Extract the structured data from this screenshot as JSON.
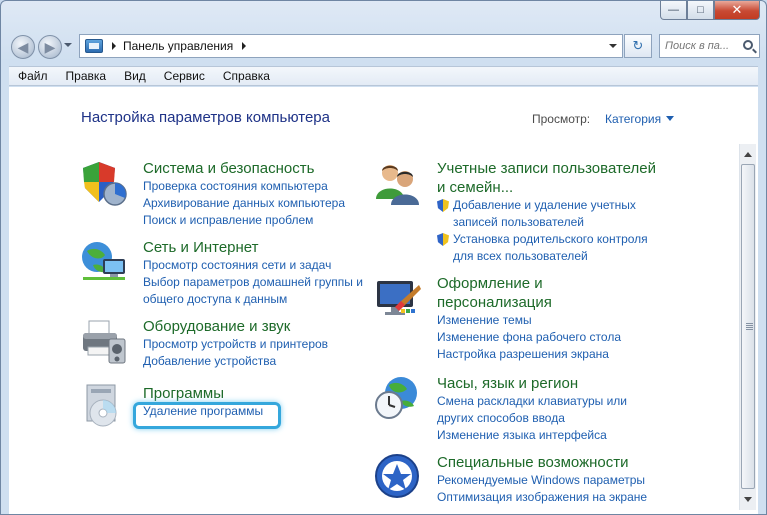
{
  "window": {
    "caption": {
      "minimize": "—",
      "maximize": "□",
      "close": "✕"
    }
  },
  "nav": {
    "back_icon": "◀",
    "forward_icon": "▶",
    "address_path": "Панель управления",
    "refresh_icon": "↻",
    "search_placeholder": "Поиск в па..."
  },
  "menu": [
    "Файл",
    "Правка",
    "Вид",
    "Сервис",
    "Справка"
  ],
  "page": {
    "title": "Настройка параметров компьютера",
    "view_label": "Просмотр:",
    "view_value": "Категория"
  },
  "categories_left": [
    {
      "title": "Система и безопасность",
      "links": [
        "Проверка состояния компьютера",
        "Архивирование данных компьютера",
        "Поиск и исправление проблем"
      ]
    },
    {
      "title": "Сеть и Интернет",
      "links": [
        "Просмотр состояния сети и задач",
        "Выбор параметров домашней группы и",
        "общего доступа к данным"
      ]
    },
    {
      "title": "Оборудование и звук",
      "links": [
        "Просмотр устройств и принтеров",
        "Добавление устройства"
      ]
    },
    {
      "title": "Программы",
      "links": [
        "Удаление программы"
      ]
    }
  ],
  "categories_right": [
    {
      "title_line1": "Учетные записи пользователей",
      "title_line2": "и семейн...",
      "links": [
        {
          "line1": "Добавление и удаление учетных",
          "line2": "записей пользователей"
        },
        {
          "line1": "Установка родительского контроля",
          "line2": "для всех пользователей"
        }
      ]
    },
    {
      "title_line1": "Оформление и",
      "title_line2": "персонализация",
      "links": [
        "Изменение темы",
        "Изменение фона рабочего стола",
        "Настройка разрешения экрана"
      ]
    },
    {
      "title": "Часы, язык и регион",
      "links": [
        "Смена раскладки клавиатуры или",
        "других способов ввода",
        "Изменение языка интерфейса"
      ]
    },
    {
      "title": "Специальные возможности",
      "links": [
        "Рекомендуемые Windows параметры",
        "Оптимизация изображения на экране"
      ]
    }
  ],
  "colors": {
    "category_title": "#1d6a29",
    "link": "#1f5fb0",
    "page_title": "#1e3287",
    "highlight": "#35a7dc"
  },
  "icons": [
    "shield-icon",
    "network-icon",
    "printer-icon",
    "programs-icon",
    "users-icon",
    "personalization-icon",
    "clock-globe-icon",
    "accessibility-icon",
    "uac-shield-icon",
    "search-icon"
  ]
}
